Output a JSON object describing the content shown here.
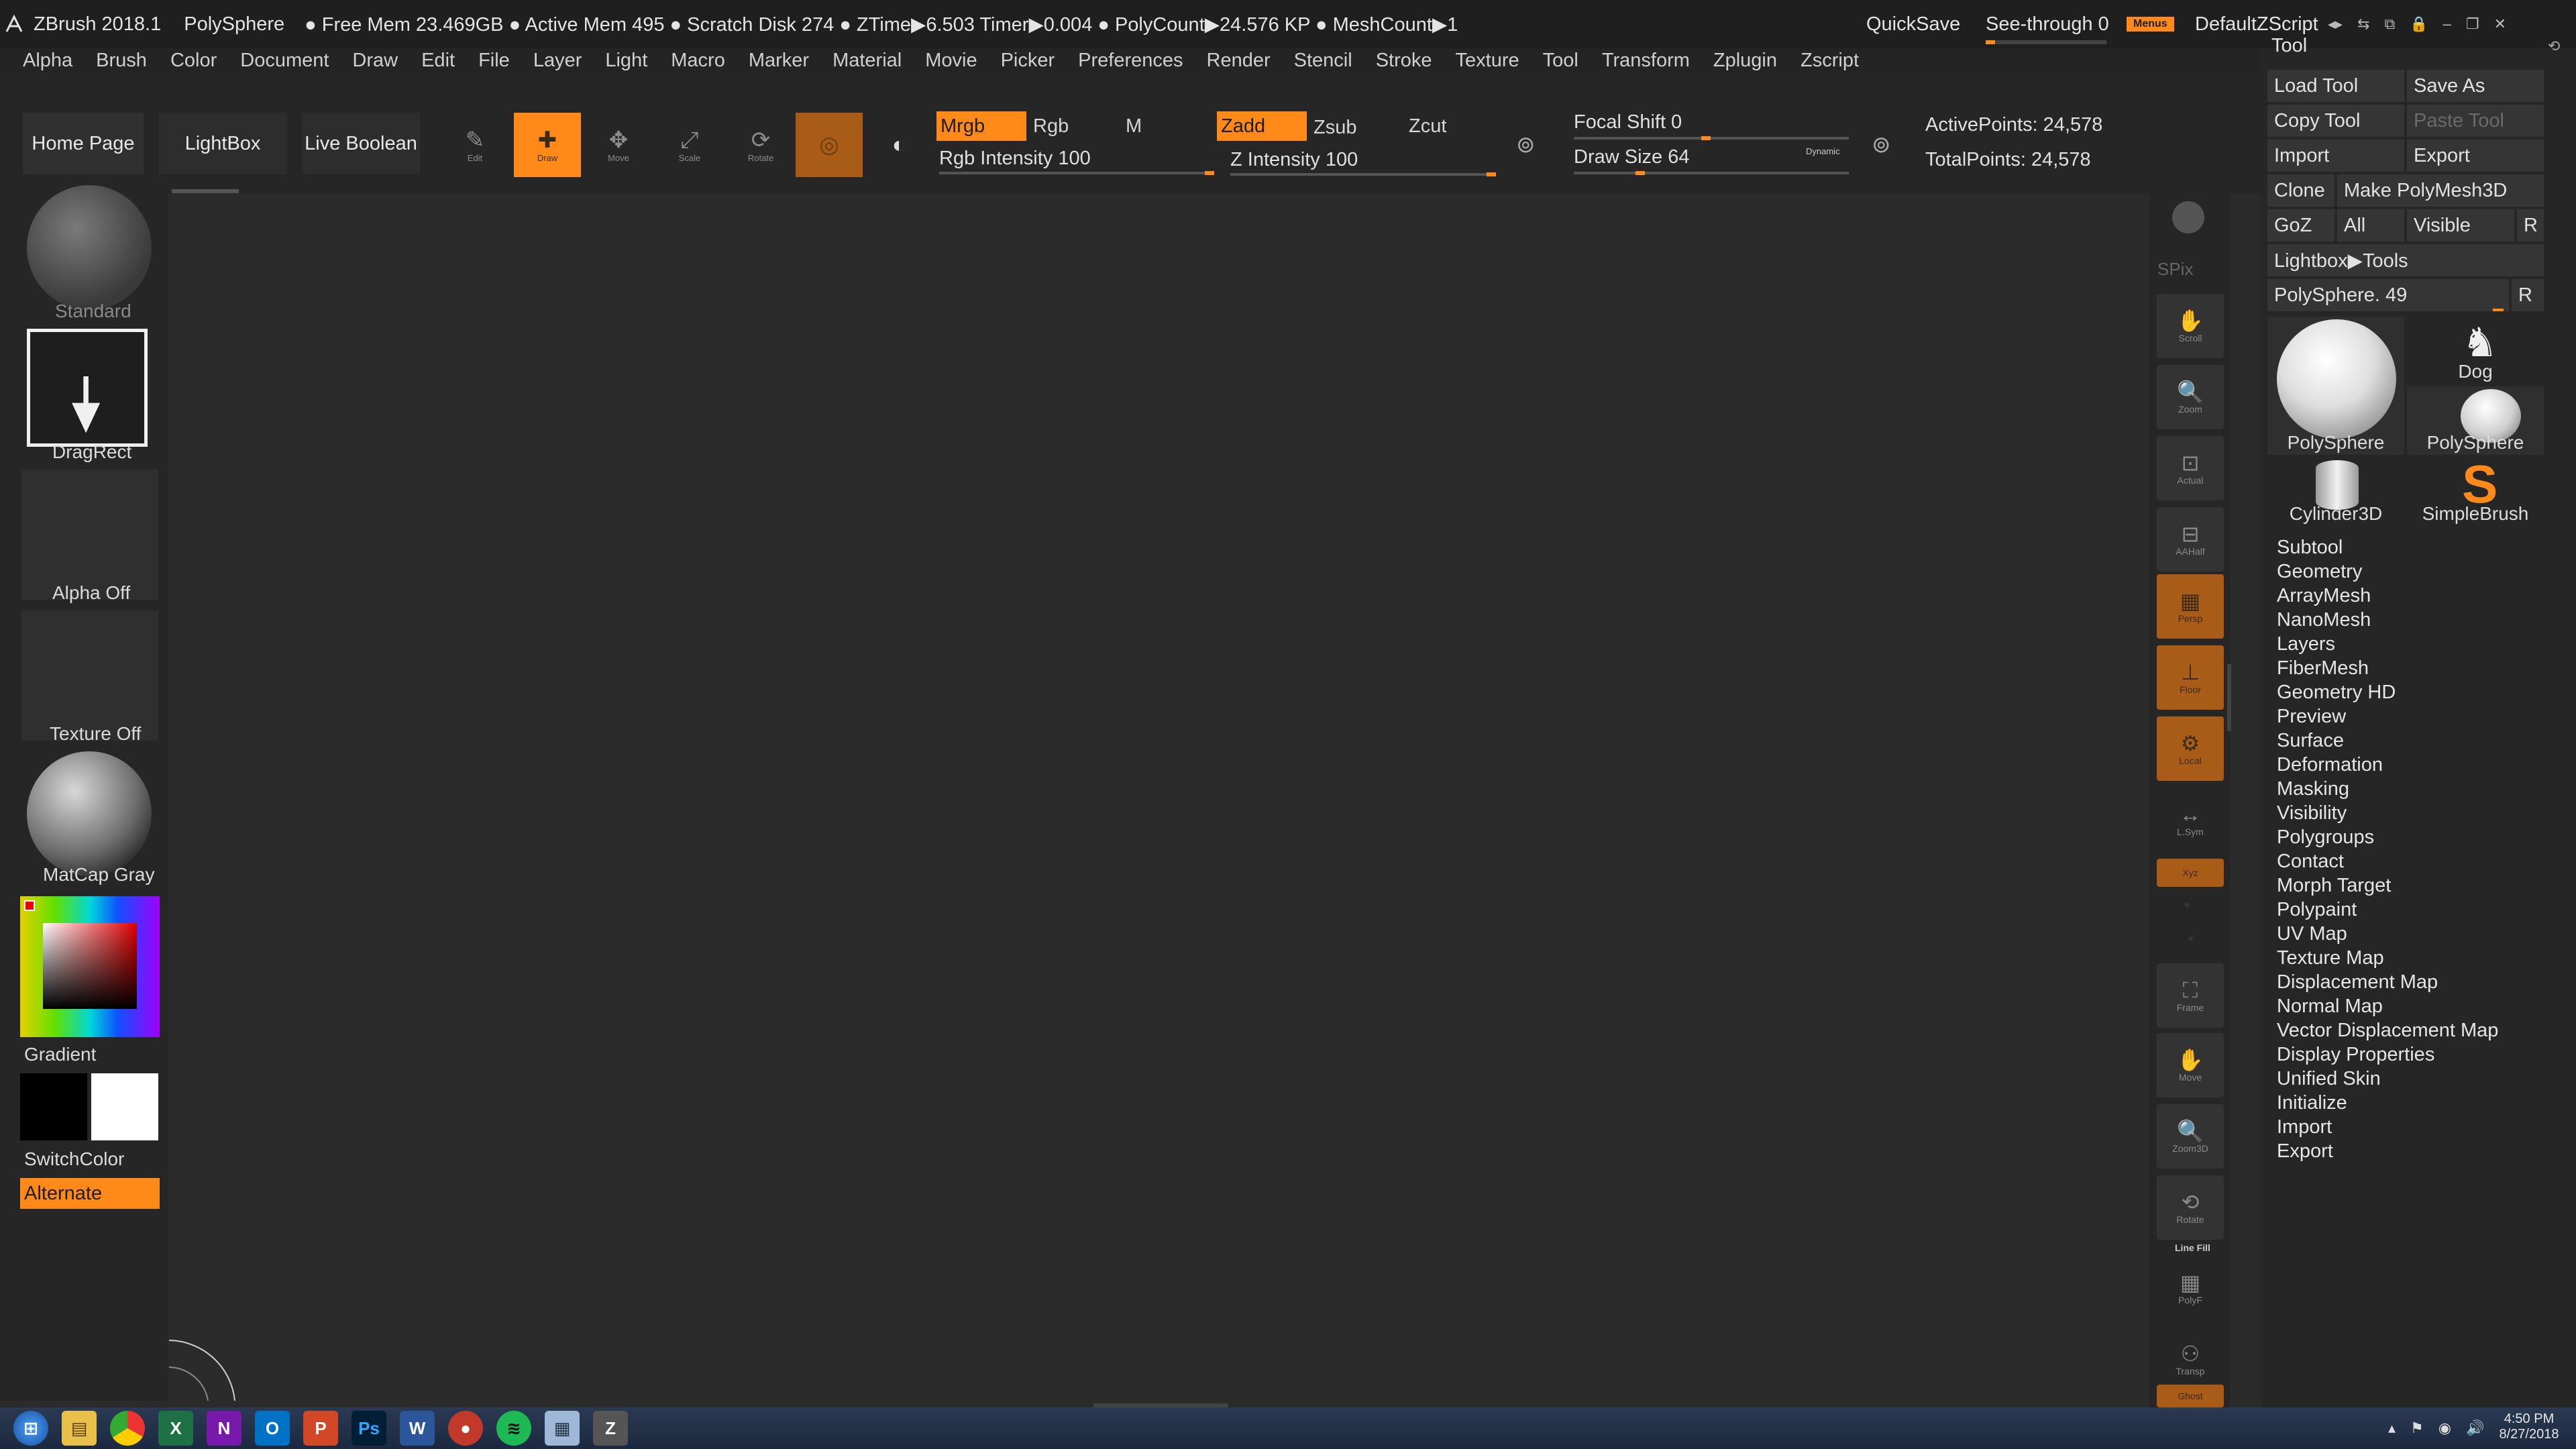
{
  "titlebar": {
    "app": "ZBrush 2018.1",
    "document": "PolySphere",
    "status": "● Free Mem 23.469GB ● Active Mem 495 ● Scratch Disk 274 ● ZTime▶6.503 Timer▶0.004 ● PolyCount▶24.576 KP ● MeshCount▶1",
    "quicksave": "QuickSave",
    "see_through": "See-through  0",
    "see_through_level": 0,
    "menus": "Menus",
    "script": "DefaultZScript"
  },
  "menubar": [
    "Alpha",
    "Brush",
    "Color",
    "Document",
    "Draw",
    "Edit",
    "File",
    "Layer",
    "Light",
    "Macro",
    "Marker",
    "Material",
    "Movie",
    "Picker",
    "Preferences",
    "Render",
    "Stencil",
    "Stroke",
    "Texture",
    "Tool",
    "Transform",
    "Zplugin",
    "Zscript"
  ],
  "shelf": {
    "home_page": "Home Page",
    "lightbox": "LightBox",
    "live_boolean": "Live Boolean",
    "tools": [
      {
        "label": "Edit",
        "icon": "edit-icon"
      },
      {
        "label": "Draw",
        "icon": "draw-icon"
      },
      {
        "label": "Move",
        "icon": "move-icon"
      },
      {
        "label": "Scale",
        "icon": "scale-icon"
      },
      {
        "label": "Rotate",
        "icon": "rotate-icon"
      }
    ],
    "mrgb": "Mrgb",
    "rgb": "Rgb",
    "m": "M",
    "zadd": "Zadd",
    "zsub": "Zsub",
    "zcut": "Zcut",
    "rgb_intensity": "Rgb Intensity 100",
    "z_intensity": "Z Intensity 100",
    "focal_shift": "Focal Shift 0",
    "draw_size": "Draw Size 64",
    "dynamic": "Dynamic",
    "active_points": "ActivePoints: 24,578",
    "total_points": "TotalPoints: 24,578"
  },
  "leftpanel": {
    "brush": "Standard",
    "stroke": "DragRect",
    "alpha": "Alpha Off",
    "texture": "Texture Off",
    "material": "MatCap Gray",
    "gradient": "Gradient",
    "switchcolor": "SwitchColor",
    "alternate": "Alternate"
  },
  "rightshelf": {
    "spix": "SPix",
    "buttons": [
      "BPR",
      "Scroll",
      "Zoom",
      "Actual",
      "AAHalf",
      "Persp",
      "Floor",
      "Local",
      "L.Sym",
      "Xyz",
      "Frame",
      "Move",
      "Zoom3D",
      "Rotate",
      "PolyF",
      "Transp",
      "Ghost"
    ],
    "line_fill": "Line Fill"
  },
  "toolpalette": {
    "title": "Tool",
    "load_tool": "Load Tool",
    "save_as": "Save As",
    "copy_tool": "Copy Tool",
    "paste_tool": "Paste Tool",
    "import": "Import",
    "export": "Export",
    "clone": "Clone",
    "make_polymesh": "Make PolyMesh3D",
    "goz": "GoZ",
    "all": "All",
    "visible": "Visible",
    "r": "R",
    "lightbox_tools": "Lightbox▶Tools",
    "polysphere_slider": "PolySphere. 49",
    "thumbs": [
      "PolySphere",
      "Dog",
      "PolySphere",
      "Cylinder3D",
      "SimpleBrush"
    ],
    "menu": [
      "Subtool",
      "Geometry",
      "ArrayMesh",
      "NanoMesh",
      "Layers",
      "FiberMesh",
      "Geometry HD",
      "Preview",
      "Surface",
      "Deformation",
      "Masking",
      "Visibility",
      "Polygroups",
      "Contact",
      "Morph Target",
      "Polypaint",
      "UV Map",
      "Texture Map",
      "Displacement Map",
      "Normal Map",
      "Vector Displacement Map",
      "Display Properties",
      "Unified Skin",
      "Initialize",
      "Import",
      "Export"
    ]
  },
  "taskbar": {
    "time": "4:50 PM",
    "date": "8/27/2018"
  },
  "colors": {
    "accent": "#ff8a1a",
    "bg": "#2b2b2b"
  }
}
